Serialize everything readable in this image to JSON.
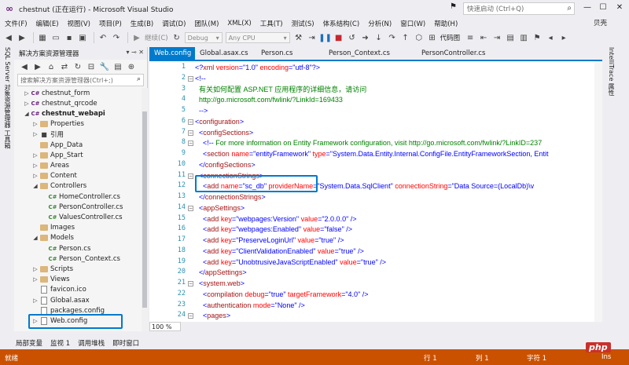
{
  "window": {
    "title": "chestnut (正在运行) - Microsoft Visual Studio",
    "quick_launch_placeholder": "快速启动 (Ctrl+Q)",
    "user": "贝壳"
  },
  "menu": [
    "文件(F)",
    "编辑(E)",
    "视图(V)",
    "项目(P)",
    "生成(B)",
    "调试(D)",
    "团队(M)",
    "XML(X)",
    "工具(T)",
    "测试(S)",
    "体系结构(C)",
    "分析(N)",
    "窗口(W)",
    "帮助(H)"
  ],
  "toolbar": {
    "continue_label": "继续(C)",
    "config": "Debug",
    "platform": "Any CPU",
    "code_map": "代码图"
  },
  "left_vertical_tabs": "SQL Server 对象资源管理器 工具箱",
  "right_vertical_tabs": "IntelliTrace 属性",
  "solution_explorer": {
    "title": "解决方案资源管理器",
    "search_placeholder": "搜索解决方案资源管理器(Ctrl+;)",
    "items": [
      {
        "label": "chestnut_form",
        "kind": "project"
      },
      {
        "label": "chestnut_qrcode",
        "kind": "project"
      },
      {
        "label": "chestnut_webapi",
        "kind": "project"
      },
      {
        "label": "Properties",
        "kind": "folder"
      },
      {
        "label": "引用",
        "kind": "refs"
      },
      {
        "label": "App_Data",
        "kind": "folder"
      },
      {
        "label": "App_Start",
        "kind": "folder"
      },
      {
        "label": "Areas",
        "kind": "folder"
      },
      {
        "label": "Content",
        "kind": "folder"
      },
      {
        "label": "Controllers",
        "kind": "folder"
      },
      {
        "label": "HomeController.cs",
        "kind": "cs"
      },
      {
        "label": "PersonController.cs",
        "kind": "cs"
      },
      {
        "label": "ValuesController.cs",
        "kind": "cs"
      },
      {
        "label": "Images",
        "kind": "folder"
      },
      {
        "label": "Models",
        "kind": "folder"
      },
      {
        "label": "Person.cs",
        "kind": "cs"
      },
      {
        "label": "Person_Context.cs",
        "kind": "cs"
      },
      {
        "label": "Scripts",
        "kind": "folder"
      },
      {
        "label": "Views",
        "kind": "folder"
      },
      {
        "label": "favicon.ico",
        "kind": "file"
      },
      {
        "label": "Global.asax",
        "kind": "file"
      },
      {
        "label": "packages.config",
        "kind": "file"
      },
      {
        "label": "Web.config",
        "kind": "file"
      }
    ]
  },
  "editor_tabs": [
    "Web.config",
    "Global.asax.cs",
    "Person.cs",
    "Person_Context.cs",
    "PersonController.cs"
  ],
  "zoom": "100 %",
  "code_lines": [
    {
      "n": "1",
      "html": "<span class='pun'>&lt;?</span><span class='kw'>xml</span> <span class='attr'>version</span><span class='pun'>=\"</span><span class='val'>1.0</span><span class='pun'>\"</span> <span class='attr'>encoding</span><span class='pun'>=\"</span><span class='val'>utf-8</span><span class='pun'>\"?&gt;</span>"
    },
    {
      "n": "2",
      "html": "<span class='pun'>&lt;!--</span>"
    },
    {
      "n": "3",
      "html": "<span class='com'>  有关如何配置 ASP.NET 应用程序的详细信息，请访问</span>"
    },
    {
      "n": "4",
      "html": "<span class='com'>  http://go.microsoft.com/fwlink/?LinkId=169433</span>"
    },
    {
      "n": "5",
      "html": "<span class='com'>  </span><span class='pun'>--&gt;</span>"
    },
    {
      "n": "6",
      "html": "<span class='pun'>&lt;</span><span class='kw'>configuration</span><span class='pun'>&gt;</span>"
    },
    {
      "n": "7",
      "html": "  <span class='pun'>&lt;</span><span class='kw'>configSections</span><span class='pun'>&gt;</span>"
    },
    {
      "n": "8",
      "html": "    <span class='pun'>&lt;!--</span><span class='com'> For more information on Entity Framework configuration, visit http://go.microsoft.com/fwlink/?LinkID=237</span>"
    },
    {
      "n": "9",
      "html": "    <span class='pun'>&lt;</span><span class='kw'>section</span> <span class='attr'>name</span><span class='pun'>=\"</span><span class='val'>entityFramework</span><span class='pun'>\"</span> <span class='attr'>type</span><span class='pun'>=\"</span><span class='val'>System.Data.Entity.Internal.ConfigFile.EntityFrameworkSection, Entit</span>"
    },
    {
      "n": "10",
      "html": "  <span class='pun'>&lt;/</span><span class='kw'>configSections</span><span class='pun'>&gt;</span>"
    },
    {
      "n": "11",
      "html": "  <span class='pun'>&lt;</span><span class='kw'>connectionStrings</span><span class='pun'>&gt;</span>"
    },
    {
      "n": "12",
      "html": "    <span class='pun'>&lt;</span><span class='kw'>add</span> <span class='attr'>name</span><span class='pun'>=\"</span><span class='val'>sc_db</span><span class='pun'>\"</span> <span class='attr'>providerName</span><span class='pun'>=\"</span><span class='val'>System.Data.SqlClient</span><span class='pun'>\"</span> <span class='attr'>connectionString</span><span class='pun'>=\"</span><span class='val'>Data Source=(LocalDb)\\v</span>"
    },
    {
      "n": "13",
      "html": "  <span class='pun'>&lt;/</span><span class='kw'>connectionStrings</span><span class='pun'>&gt;</span>"
    },
    {
      "n": "14",
      "html": "  <span class='pun'>&lt;</span><span class='kw'>appSettings</span><span class='pun'>&gt;</span>"
    },
    {
      "n": "15",
      "html": "    <span class='pun'>&lt;</span><span class='kw'>add</span> <span class='attr'>key</span><span class='pun'>=\"</span><span class='val'>webpages:Version</span><span class='pun'>\"</span> <span class='attr'>value</span><span class='pun'>=\"</span><span class='val'>2.0.0.0</span><span class='pun'>\" /&gt;</span>"
    },
    {
      "n": "16",
      "html": "    <span class='pun'>&lt;</span><span class='kw'>add</span> <span class='attr'>key</span><span class='pun'>=\"</span><span class='val'>webpages:Enabled</span><span class='pun'>\"</span> <span class='attr'>value</span><span class='pun'>=\"</span><span class='val'>false</span><span class='pun'>\" /&gt;</span>"
    },
    {
      "n": "17",
      "html": "    <span class='pun'>&lt;</span><span class='kw'>add</span> <span class='attr'>key</span><span class='pun'>=\"</span><span class='val'>PreserveLoginUrl</span><span class='pun'>\"</span> <span class='attr'>value</span><span class='pun'>=\"</span><span class='val'>true</span><span class='pun'>\" /&gt;</span>"
    },
    {
      "n": "18",
      "html": "    <span class='pun'>&lt;</span><span class='kw'>add</span> <span class='attr'>key</span><span class='pun'>=\"</span><span class='val'>ClientValidationEnabled</span><span class='pun'>\"</span> <span class='attr'>value</span><span class='pun'>=\"</span><span class='val'>true</span><span class='pun'>\" /&gt;</span>"
    },
    {
      "n": "19",
      "html": "    <span class='pun'>&lt;</span><span class='kw'>add</span> <span class='attr'>key</span><span class='pun'>=\"</span><span class='val'>UnobtrusiveJavaScriptEnabled</span><span class='pun'>\"</span> <span class='attr'>value</span><span class='pun'>=\"</span><span class='val'>true</span><span class='pun'>\" /&gt;</span>"
    },
    {
      "n": "20",
      "html": "  <span class='pun'>&lt;/</span><span class='kw'>appSettings</span><span class='pun'>&gt;</span>"
    },
    {
      "n": "21",
      "html": "  <span class='pun'>&lt;</span><span class='kw'>system.web</span><span class='pun'>&gt;</span>"
    },
    {
      "n": "22",
      "html": "    <span class='pun'>&lt;</span><span class='kw'>compilation</span> <span class='attr'>debug</span><span class='pun'>=\"</span><span class='val'>true</span><span class='pun'>\"</span> <span class='attr'>targetFramework</span><span class='pun'>=\"</span><span class='val'>4.0</span><span class='pun'>\" /&gt;</span>"
    },
    {
      "n": "23",
      "html": "    <span class='pun'>&lt;</span><span class='kw'>authentication</span> <span class='attr'>mode</span><span class='pun'>=\"</span><span class='val'>None</span><span class='pun'>\" /&gt;</span>"
    },
    {
      "n": "24",
      "html": "    <span class='pun'>&lt;</span><span class='kw'>pages</span><span class='pun'>&gt;</span>"
    }
  ],
  "bottom_tabs": [
    "局部变量",
    "监视 1",
    "调用堆栈",
    "即时窗口"
  ],
  "status": {
    "ready": "就绪",
    "line": "行 1",
    "col": "列 1",
    "char": "字符 1",
    "ins": "Ins"
  },
  "colors": {
    "accent": "#007acc",
    "status_bar": "#ca5100"
  }
}
